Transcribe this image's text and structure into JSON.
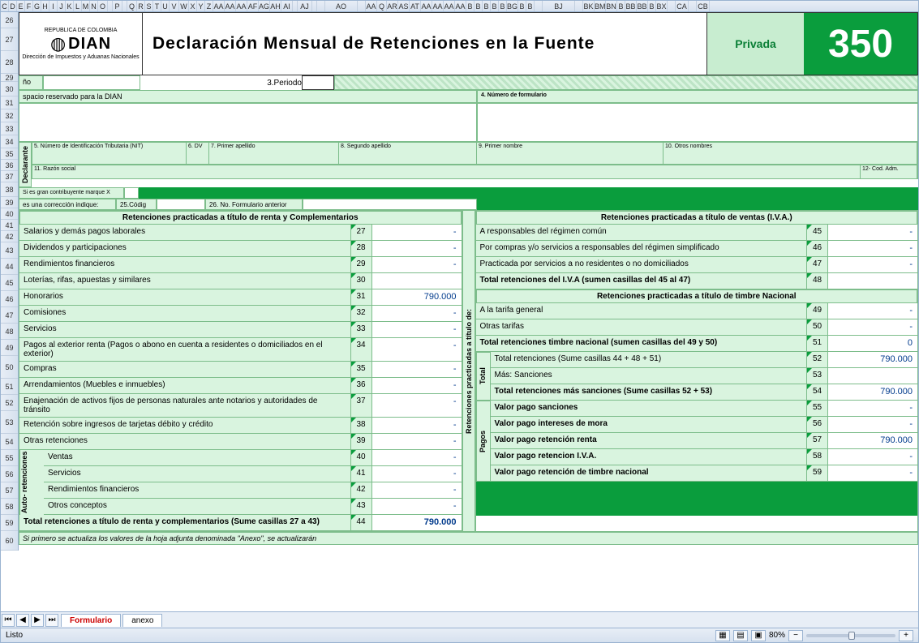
{
  "ruler_cols": [
    "C",
    "D",
    "E",
    "F",
    "G",
    "H",
    "I",
    "J",
    "K",
    "L",
    "M",
    "N",
    "O",
    " ",
    "P",
    " ",
    "Q",
    "R",
    "S",
    "T",
    "U",
    "V",
    "W",
    "X",
    "Y",
    "Z",
    "AA",
    "AA",
    "AA",
    "AF",
    "AG",
    "AH",
    "AI",
    " ",
    "AJ",
    " ",
    "",
    "AO",
    "",
    "AA",
    "Q",
    "AR",
    "AS",
    "AT",
    "AA",
    "AA",
    "AA",
    "AA",
    "B",
    "B",
    "B",
    "B",
    "B",
    "BG",
    "B",
    "B",
    "",
    "BJ",
    "",
    "BK",
    "BM",
    "BN",
    "B",
    "BB",
    "BB",
    "B",
    "BX",
    "",
    "CA",
    "",
    "CB"
  ],
  "ruler_rows": [
    "26",
    "27",
    "28",
    "29",
    "30",
    "31",
    "32",
    "33",
    "34",
    "35",
    "36",
    "37",
    "38",
    "39",
    "40",
    "41",
    "42",
    "43",
    "44",
    "45",
    "46",
    "47",
    "48",
    "49",
    "50",
    "51",
    "52",
    "53",
    "54",
    "55",
    "56",
    "57",
    "58",
    "59",
    "60"
  ],
  "header": {
    "country": "REPUBLICA DE COLOMBIA",
    "org": "DIAN",
    "org_sub": "Dirección de Impuestos y Aduanas Nacionales",
    "title": "Declaración Mensual de Retenciones en la Fuente",
    "badge": "Privada",
    "form_no": "350"
  },
  "top": {
    "ano": "ño",
    "periodo_lbl": "3.Periodo",
    "reserved": "spacio reservado para la DIAN",
    "num_formulario": "4. Número de formulario"
  },
  "id": {
    "nit": "5. Número de Identificación Tributaria (NIT)",
    "dv": "6. DV",
    "ap1": "7. Primer apellido",
    "ap2": "8. Segundo apellido",
    "nom1": "9. Primer nombre",
    "nom2": "10. Otros nombres",
    "razon": "11. Razón social",
    "cod": "12- Cod. Adm.",
    "gran": "Si es gran contribuyente marque X",
    "corr": "es una corrección indique:",
    "codig": "25.Códig",
    "noform": "26. No. Formulario anterior"
  },
  "sections": {
    "renta": "Retenciones practicadas a título de renta y Complementarios",
    "iva": "Retenciones practicadas a título de ventas (I.V.A.)",
    "timbre": "Retenciones practicadas a título de timbre Nacional",
    "rot_titulo": "Retenciones practicadas a título de:",
    "rot_total": "Total",
    "rot_pagos": "Pagos",
    "rot_auto": "Auto-\nretenciones",
    "rot_decl": "Declarante"
  },
  "rows_left": [
    {
      "lbl": "Salarios y demás pagos laborales",
      "n": "27",
      "v": "-"
    },
    {
      "lbl": "Dividendos y participaciones",
      "n": "28",
      "v": "-"
    },
    {
      "lbl": "Rendimientos financieros",
      "n": "29",
      "v": "-"
    },
    {
      "lbl": "Loterías, rifas, apuestas y similares",
      "n": "30",
      "v": ""
    },
    {
      "lbl": "Honorarios",
      "n": "31",
      "v": "790.000"
    },
    {
      "lbl": "Comisiones",
      "n": "32",
      "v": "-"
    },
    {
      "lbl": "Servicios",
      "n": "33",
      "v": "-"
    },
    {
      "lbl": "Pagos al exterior renta (Pagos o abono en cuenta a residentes o domiciliados en el exterior)",
      "n": "34",
      "v": "-"
    },
    {
      "lbl": "Compras",
      "n": "35",
      "v": "-"
    },
    {
      "lbl": "Arrendamientos (Muebles e inmuebles)",
      "n": "36",
      "v": "-"
    },
    {
      "lbl": "Enajenación de activos fijos de personas naturales ante notarios y autoridades de tránsito",
      "n": "37",
      "v": "-"
    },
    {
      "lbl": "Retención sobre ingresos de tarjetas débito y crédito",
      "n": "38",
      "v": "-"
    },
    {
      "lbl": "Otras retenciones",
      "n": "39",
      "v": "-"
    }
  ],
  "rows_auto": [
    {
      "lbl": "Ventas",
      "n": "40",
      "v": "-"
    },
    {
      "lbl": "Servicios",
      "n": "41",
      "v": "-"
    },
    {
      "lbl": "Rendimientos financieros",
      "n": "42",
      "v": "-"
    },
    {
      "lbl": "Otros conceptos",
      "n": "43",
      "v": "-"
    }
  ],
  "total_left": {
    "lbl": "Total retenciones a título de renta y complementarios (Sume casillas 27 a 43)",
    "n": "44",
    "v": "790.000"
  },
  "rows_iva": [
    {
      "lbl": "A responsables del régimen común",
      "n": "45",
      "v": "-"
    },
    {
      "lbl": "Por compras y/o servicios a responsables del régimen simplificado",
      "n": "46",
      "v": "-"
    },
    {
      "lbl": "Practicada por servicios a no residentes o no domiciliados",
      "n": "47",
      "v": "-"
    },
    {
      "lbl": "Total retenciones del I.V.A (sumen casillas del 45 al 47)",
      "n": "48",
      "v": "",
      "bold": true
    }
  ],
  "rows_timbre": [
    {
      "lbl": "A la tarifa general",
      "n": "49",
      "v": "-"
    },
    {
      "lbl": "Otras tarifas",
      "n": "50",
      "v": "-"
    },
    {
      "lbl": "Total retenciones timbre nacional (sumen casillas del 49 y 50)",
      "n": "51",
      "v": "0",
      "bold": true
    }
  ],
  "rows_total": [
    {
      "lbl": "Total retenciones (Sume casillas 44 + 48 + 51)",
      "n": "52",
      "v": "790.000"
    },
    {
      "lbl": "Más: Sanciones",
      "n": "53",
      "v": ""
    },
    {
      "lbl": "Total retenciones más sanciones (Sume casillas 52 + 53)",
      "n": "54",
      "v": "790.000",
      "bold": true
    }
  ],
  "rows_pagos": [
    {
      "lbl": "Valor pago sanciones",
      "n": "55",
      "v": "-",
      "bold": true
    },
    {
      "lbl": "Valor pago intereses de mora",
      "n": "56",
      "v": "-",
      "bold": true
    },
    {
      "lbl": "Valor pago retención renta",
      "n": "57",
      "v": "790.000",
      "bold": true
    },
    {
      "lbl": "Valor pago retencion I.V.A.",
      "n": "58",
      "v": "-",
      "bold": true
    },
    {
      "lbl": "Valor pago retención de timbre nacional",
      "n": "59",
      "v": "-",
      "bold": true
    }
  ],
  "footer_note": "Si primero se actualiza los valores de la hoja adjunta denominada \"Anexo\", se actualizarán",
  "tabs": {
    "t1": "Formulario",
    "t2": "anexo"
  },
  "status": {
    "ready": "Listo",
    "zoom": "80%"
  }
}
